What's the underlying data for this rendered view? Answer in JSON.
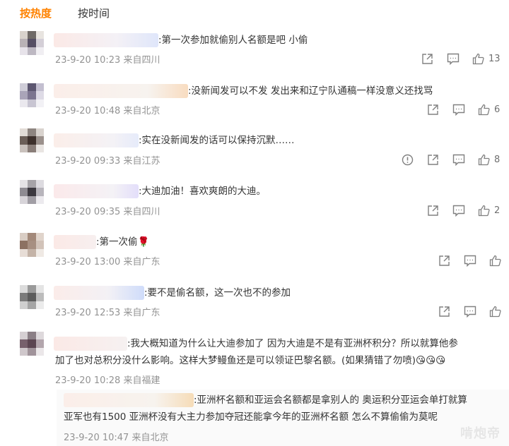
{
  "tabs": {
    "hot": "按热度",
    "time": "按时间"
  },
  "comments": [
    {
      "text": ":第一次参加就偷别人名额是吧 小偷",
      "meta": "23-9-20 10:23 来自四川",
      "likes": "13"
    },
    {
      "text": ":没新闻发可以不发 发出来和辽宁队通稿一样没意义还找骂",
      "meta": "23-9-20 10:48 来自北京",
      "likes": "6"
    },
    {
      "text": ":实在没新闻发的话可以保持沉默……",
      "meta": "23-9-20 09:33 来自江苏",
      "likes": "8"
    },
    {
      "text": ":大迪加油！喜欢爽朗的大迪。",
      "meta": "23-9-20 09:35 来自四川",
      "likes": "2"
    },
    {
      "text": ":第一次偷🌹",
      "meta": "23-9-20 13:00 来自广东",
      "likes": ""
    },
    {
      "text": ":要不是偷名额，这一次也不的参加",
      "meta": "23-9-20 12:53 来自广东",
      "likes": ""
    },
    {
      "text_line1": ":我大概知道为什么让大迪参加了 因为大迪是不是有亚洲杯积分？所以就算他参",
      "text_line2": "加了也对总积分没什么影响。这样大梦鳗鱼还是可以领证巴黎名额。(如果猜错了勿喷)😘😘😘",
      "meta": "23-9-20 10:28 来自福建",
      "likes": ""
    }
  ],
  "reply": {
    "text_line1": ":亚洲杯名额和亚运会名额都是拿别人的 奥运积分亚运会单打就算",
    "text_line2": "亚军也有1500 亚洲杯没有大主力参加夺冠还能拿今年的亚洲杯名额 怎么不算偷偷为莫呢",
    "meta": "23-9-20 10:47 来自北京"
  },
  "watermark": "啃炮帝",
  "colors": {
    "accent": "#ff8200",
    "meta": "#939393",
    "icon": "#808080"
  }
}
